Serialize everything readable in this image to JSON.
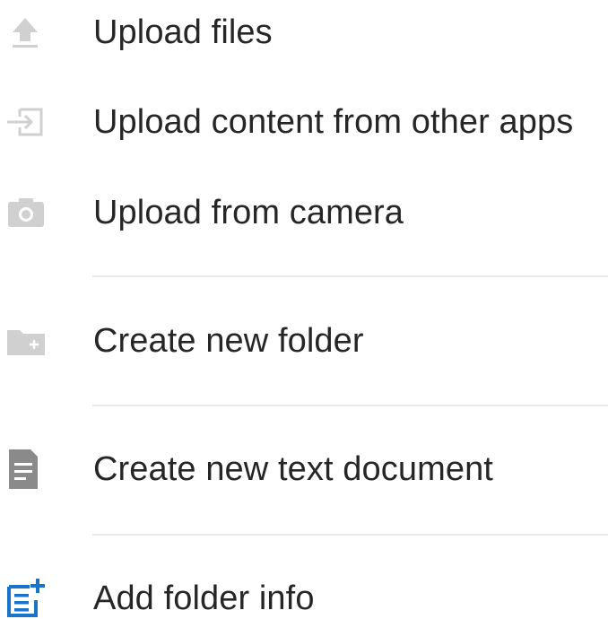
{
  "menu": {
    "items": [
      {
        "label": "Upload files",
        "icon": "upload-icon",
        "color": "#d0d0d0"
      },
      {
        "label": "Upload content from other apps",
        "icon": "import-icon",
        "color": "#d0d0d0"
      },
      {
        "label": "Upload from camera",
        "icon": "camera-icon",
        "color": "#d0d0d0"
      },
      {
        "label": "Create new folder",
        "icon": "new-folder-icon",
        "color": "#d0d0d0"
      },
      {
        "label": "Create new text document",
        "icon": "text-document-icon",
        "color": "#8a8a8a"
      },
      {
        "label": "Add folder info",
        "icon": "add-info-icon",
        "color": "#1a73c8"
      }
    ]
  }
}
